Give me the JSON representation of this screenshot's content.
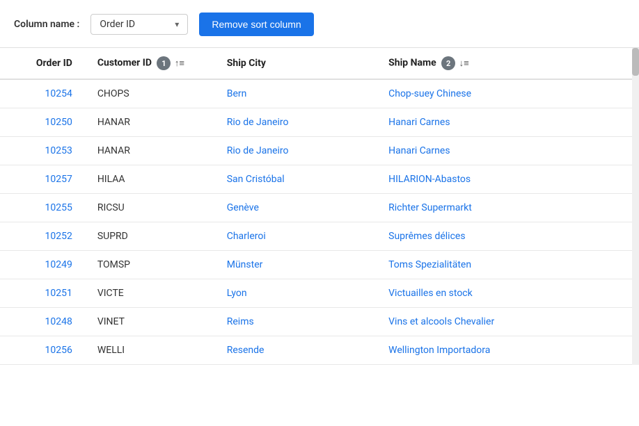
{
  "controls": {
    "column_name_label": "Column name :",
    "dropdown": {
      "value": "Order ID",
      "options": [
        "Order ID",
        "Customer ID",
        "Ship City",
        "Ship Name"
      ]
    },
    "remove_button_label": "Remove sort column"
  },
  "table": {
    "columns": [
      {
        "key": "order_id",
        "label": "Order ID",
        "sort_badge": null,
        "sort_icon": null
      },
      {
        "key": "customer_id",
        "label": "Customer ID",
        "sort_badge": "1",
        "sort_icon": "↑≡"
      },
      {
        "key": "ship_city",
        "label": "Ship City",
        "sort_badge": null,
        "sort_icon": null
      },
      {
        "key": "ship_name",
        "label": "Ship Name",
        "sort_badge": "2",
        "sort_icon": "↓≡"
      }
    ],
    "rows": [
      {
        "order_id": "10254",
        "customer_id": "CHOPS",
        "ship_city": "Bern",
        "ship_name": "Chop-suey Chinese"
      },
      {
        "order_id": "10250",
        "customer_id": "HANAR",
        "ship_city": "Rio de Janeiro",
        "ship_name": "Hanari Carnes"
      },
      {
        "order_id": "10253",
        "customer_id": "HANAR",
        "ship_city": "Rio de Janeiro",
        "ship_name": "Hanari Carnes"
      },
      {
        "order_id": "10257",
        "customer_id": "HILAA",
        "ship_city": "San Cristóbal",
        "ship_name": "HILARION-Abastos"
      },
      {
        "order_id": "10255",
        "customer_id": "RICSU",
        "ship_city": "Genève",
        "ship_name": "Richter Supermarkt"
      },
      {
        "order_id": "10252",
        "customer_id": "SUPRD",
        "ship_city": "Charleroi",
        "ship_name": "Suprêmes délices"
      },
      {
        "order_id": "10249",
        "customer_id": "TOMSP",
        "ship_city": "Münster",
        "ship_name": "Toms Spezialitäten"
      },
      {
        "order_id": "10251",
        "customer_id": "VICTE",
        "ship_city": "Lyon",
        "ship_name": "Victuailles en stock"
      },
      {
        "order_id": "10248",
        "customer_id": "VINET",
        "ship_city": "Reims",
        "ship_name": "Vins et alcools Chevalier"
      },
      {
        "order_id": "10256",
        "customer_id": "WELLI",
        "ship_city": "Resende",
        "ship_name": "Wellington Importadora"
      }
    ]
  }
}
